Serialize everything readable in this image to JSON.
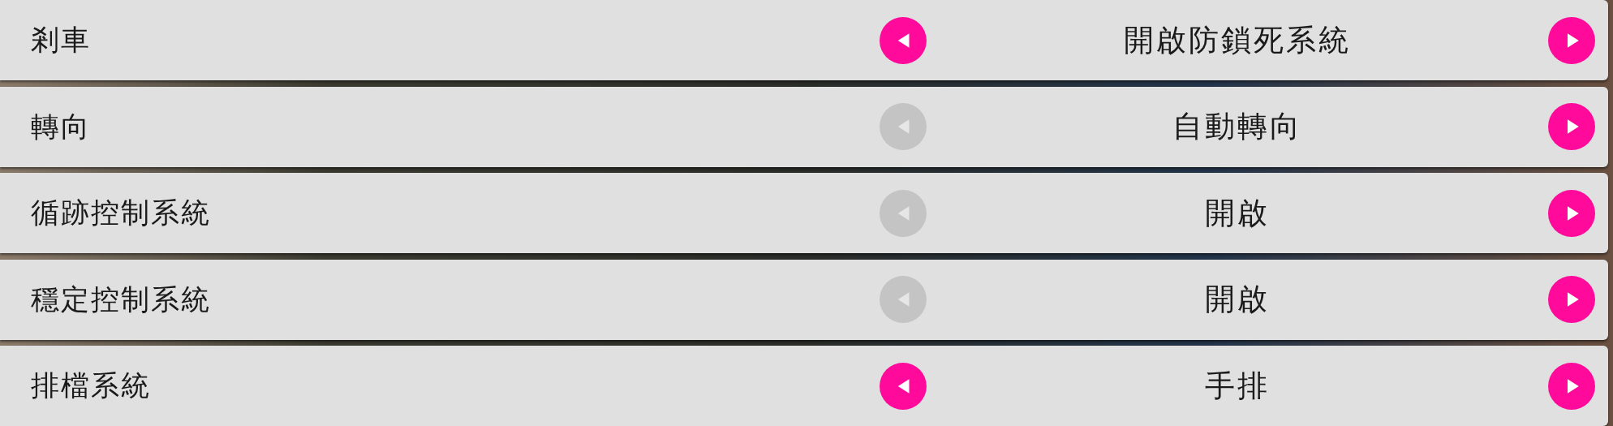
{
  "settings": [
    {
      "label": "剎車",
      "value": "開啟防鎖死系統",
      "prev_enabled": true,
      "next_enabled": true
    },
    {
      "label": "轉向",
      "value": "自動轉向",
      "prev_enabled": false,
      "next_enabled": true
    },
    {
      "label": "循跡控制系統",
      "value": "開啟",
      "prev_enabled": false,
      "next_enabled": true
    },
    {
      "label": "穩定控制系統",
      "value": "開啟",
      "prev_enabled": false,
      "next_enabled": true
    },
    {
      "label": "排檔系統",
      "value": "手排",
      "prev_enabled": true,
      "next_enabled": true
    }
  ]
}
